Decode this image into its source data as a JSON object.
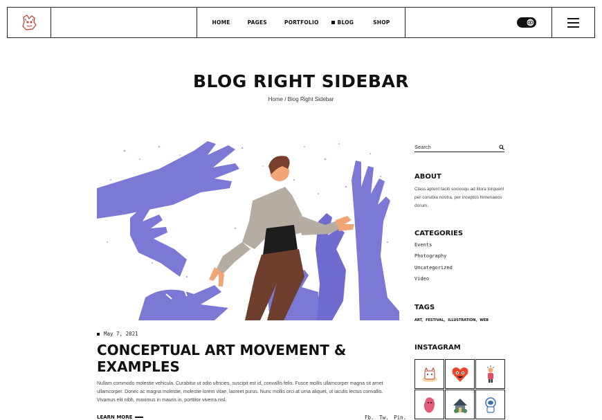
{
  "header": {
    "nav": [
      "HOME",
      "PAGES",
      "PORTFOLIO",
      "BLOG",
      "SHOP"
    ]
  },
  "page": {
    "title": "BLOG RIGHT SIDEBAR",
    "breadcrumb_home": "Home",
    "breadcrumb_sep": " / ",
    "breadcrumb_current": "Blog Right Sidebar"
  },
  "post": {
    "date": "May 7, 2021",
    "title": "CONCEPTUAL ART MOVEMENT & EXAMPLES",
    "excerpt": "Nullam commodo molestie vehicula. Curabitur ut odio ultricies, suscipit est id, convallis felis. Fusce mollis ullamcorper magna sit amet ullamcorper. Donec ac magna molestie, molestie lorem vitae, laoreet purus. Nunc mollis orci at urna aliquet, ut iaculis lectus convallis. Vivamus elit nibh, maximus in mauris in, porttitor viverra nisl.",
    "read_more": "LEARN MORE",
    "share": [
      "Fb.",
      "Tw.",
      "Pin."
    ]
  },
  "sidebar": {
    "search_placeholder": "Search",
    "about_title": "ABOUT",
    "about_text": "Class aptent taciti sociosqu ad litora torquent per conubia nostra, per inceptos himenaeos dorum.",
    "categories_title": "CATEGORIES",
    "categories": [
      "Events",
      "Photography",
      "Uncategorized",
      "Video"
    ],
    "tags_title": "TAGS",
    "tags": [
      "ART,",
      "FESTIVAL,",
      "ILLUSTRATION,",
      "WEB"
    ],
    "instagram_title": "INSTAGRAM"
  },
  "colors": {
    "accent_purple": "#7b78d6",
    "text": "#111111"
  }
}
